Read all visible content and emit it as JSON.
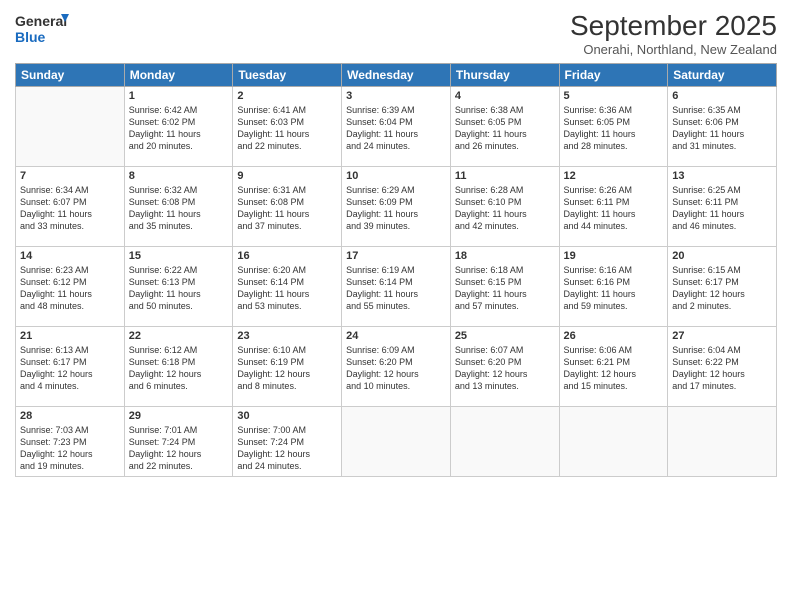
{
  "logo": {
    "line1": "General",
    "line2": "Blue"
  },
  "title": "September 2025",
  "subtitle": "Onerahi, Northland, New Zealand",
  "weekdays": [
    "Sunday",
    "Monday",
    "Tuesday",
    "Wednesday",
    "Thursday",
    "Friday",
    "Saturday"
  ],
  "weeks": [
    [
      {
        "day": "",
        "info": ""
      },
      {
        "day": "1",
        "info": "Sunrise: 6:42 AM\nSunset: 6:02 PM\nDaylight: 11 hours\nand 20 minutes."
      },
      {
        "day": "2",
        "info": "Sunrise: 6:41 AM\nSunset: 6:03 PM\nDaylight: 11 hours\nand 22 minutes."
      },
      {
        "day": "3",
        "info": "Sunrise: 6:39 AM\nSunset: 6:04 PM\nDaylight: 11 hours\nand 24 minutes."
      },
      {
        "day": "4",
        "info": "Sunrise: 6:38 AM\nSunset: 6:05 PM\nDaylight: 11 hours\nand 26 minutes."
      },
      {
        "day": "5",
        "info": "Sunrise: 6:36 AM\nSunset: 6:05 PM\nDaylight: 11 hours\nand 28 minutes."
      },
      {
        "day": "6",
        "info": "Sunrise: 6:35 AM\nSunset: 6:06 PM\nDaylight: 11 hours\nand 31 minutes."
      }
    ],
    [
      {
        "day": "7",
        "info": "Sunrise: 6:34 AM\nSunset: 6:07 PM\nDaylight: 11 hours\nand 33 minutes."
      },
      {
        "day": "8",
        "info": "Sunrise: 6:32 AM\nSunset: 6:08 PM\nDaylight: 11 hours\nand 35 minutes."
      },
      {
        "day": "9",
        "info": "Sunrise: 6:31 AM\nSunset: 6:08 PM\nDaylight: 11 hours\nand 37 minutes."
      },
      {
        "day": "10",
        "info": "Sunrise: 6:29 AM\nSunset: 6:09 PM\nDaylight: 11 hours\nand 39 minutes."
      },
      {
        "day": "11",
        "info": "Sunrise: 6:28 AM\nSunset: 6:10 PM\nDaylight: 11 hours\nand 42 minutes."
      },
      {
        "day": "12",
        "info": "Sunrise: 6:26 AM\nSunset: 6:11 PM\nDaylight: 11 hours\nand 44 minutes."
      },
      {
        "day": "13",
        "info": "Sunrise: 6:25 AM\nSunset: 6:11 PM\nDaylight: 11 hours\nand 46 minutes."
      }
    ],
    [
      {
        "day": "14",
        "info": "Sunrise: 6:23 AM\nSunset: 6:12 PM\nDaylight: 11 hours\nand 48 minutes."
      },
      {
        "day": "15",
        "info": "Sunrise: 6:22 AM\nSunset: 6:13 PM\nDaylight: 11 hours\nand 50 minutes."
      },
      {
        "day": "16",
        "info": "Sunrise: 6:20 AM\nSunset: 6:14 PM\nDaylight: 11 hours\nand 53 minutes."
      },
      {
        "day": "17",
        "info": "Sunrise: 6:19 AM\nSunset: 6:14 PM\nDaylight: 11 hours\nand 55 minutes."
      },
      {
        "day": "18",
        "info": "Sunrise: 6:18 AM\nSunset: 6:15 PM\nDaylight: 11 hours\nand 57 minutes."
      },
      {
        "day": "19",
        "info": "Sunrise: 6:16 AM\nSunset: 6:16 PM\nDaylight: 11 hours\nand 59 minutes."
      },
      {
        "day": "20",
        "info": "Sunrise: 6:15 AM\nSunset: 6:17 PM\nDaylight: 12 hours\nand 2 minutes."
      }
    ],
    [
      {
        "day": "21",
        "info": "Sunrise: 6:13 AM\nSunset: 6:17 PM\nDaylight: 12 hours\nand 4 minutes."
      },
      {
        "day": "22",
        "info": "Sunrise: 6:12 AM\nSunset: 6:18 PM\nDaylight: 12 hours\nand 6 minutes."
      },
      {
        "day": "23",
        "info": "Sunrise: 6:10 AM\nSunset: 6:19 PM\nDaylight: 12 hours\nand 8 minutes."
      },
      {
        "day": "24",
        "info": "Sunrise: 6:09 AM\nSunset: 6:20 PM\nDaylight: 12 hours\nand 10 minutes."
      },
      {
        "day": "25",
        "info": "Sunrise: 6:07 AM\nSunset: 6:20 PM\nDaylight: 12 hours\nand 13 minutes."
      },
      {
        "day": "26",
        "info": "Sunrise: 6:06 AM\nSunset: 6:21 PM\nDaylight: 12 hours\nand 15 minutes."
      },
      {
        "day": "27",
        "info": "Sunrise: 6:04 AM\nSunset: 6:22 PM\nDaylight: 12 hours\nand 17 minutes."
      }
    ],
    [
      {
        "day": "28",
        "info": "Sunrise: 7:03 AM\nSunset: 7:23 PM\nDaylight: 12 hours\nand 19 minutes."
      },
      {
        "day": "29",
        "info": "Sunrise: 7:01 AM\nSunset: 7:24 PM\nDaylight: 12 hours\nand 22 minutes."
      },
      {
        "day": "30",
        "info": "Sunrise: 7:00 AM\nSunset: 7:24 PM\nDaylight: 12 hours\nand 24 minutes."
      },
      {
        "day": "",
        "info": ""
      },
      {
        "day": "",
        "info": ""
      },
      {
        "day": "",
        "info": ""
      },
      {
        "day": "",
        "info": ""
      }
    ]
  ]
}
